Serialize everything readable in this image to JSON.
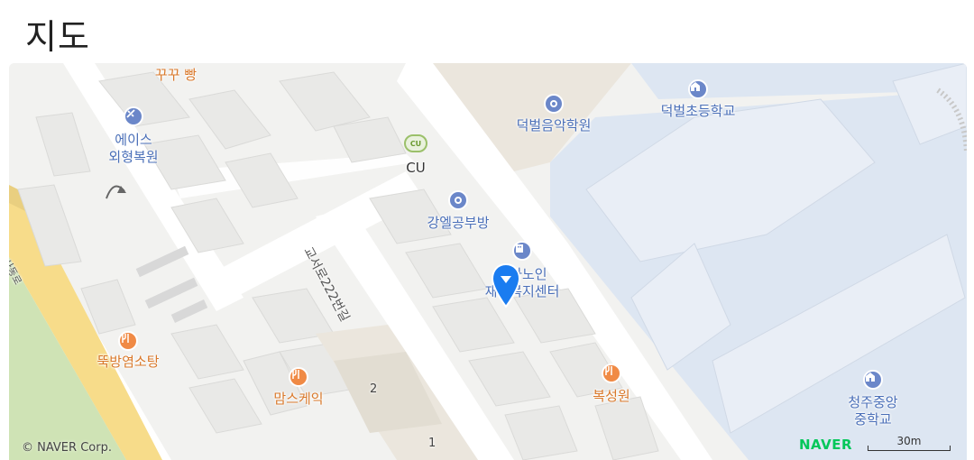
{
  "section_title": "지도",
  "map": {
    "pois": [
      {
        "id": "kkukku",
        "label": "꾸꾸 빵",
        "kind": "orange",
        "icon": "none"
      },
      {
        "id": "aces",
        "label_line1": "에이스",
        "label_line2": "외형복원",
        "kind": "blue",
        "icon": "wrench-icon"
      },
      {
        "id": "cu",
        "label": "CU",
        "kind": "dark",
        "icon": "convenience-store-icon"
      },
      {
        "id": "deokbeol-music",
        "label": "덕벌음악학원",
        "kind": "blue",
        "icon": "academy-icon"
      },
      {
        "id": "deokbeol-school",
        "label": "덕벌초등학교",
        "kind": "blue",
        "icon": "school-icon"
      },
      {
        "id": "gangel",
        "label": "강엘공부방",
        "kind": "blue",
        "icon": "academy-icon"
      },
      {
        "id": "hyoja",
        "label_line1": "효자노인",
        "label_line2": "재가복지센터",
        "kind": "blue",
        "icon": "welfare-icon"
      },
      {
        "id": "ttukbang",
        "label": "뚝방염소탕",
        "kind": "orange",
        "icon": "restaurant-icon"
      },
      {
        "id": "moms",
        "label": "맘스케익",
        "kind": "orange",
        "icon": "restaurant-icon"
      },
      {
        "id": "boksung",
        "label": "복성원",
        "kind": "orange",
        "icon": "restaurant-icon"
      },
      {
        "id": "cheongju",
        "label_line1": "청주중앙",
        "label_line2": "중학교",
        "kind": "blue",
        "icon": "school-icon"
      }
    ],
    "road_label": "교서로222번길",
    "side_road_label": "사동로",
    "lot_numbers": [
      "2",
      "1"
    ],
    "copyright": "© NAVER Corp.",
    "logo": "NAVER",
    "scale": "30m",
    "colors": {
      "school_area": "#dde6f2",
      "main_road": "#f7dc8a",
      "park": "#cfe3b5",
      "marker": "#1a7cf0",
      "naver_green": "#03c75a"
    }
  }
}
